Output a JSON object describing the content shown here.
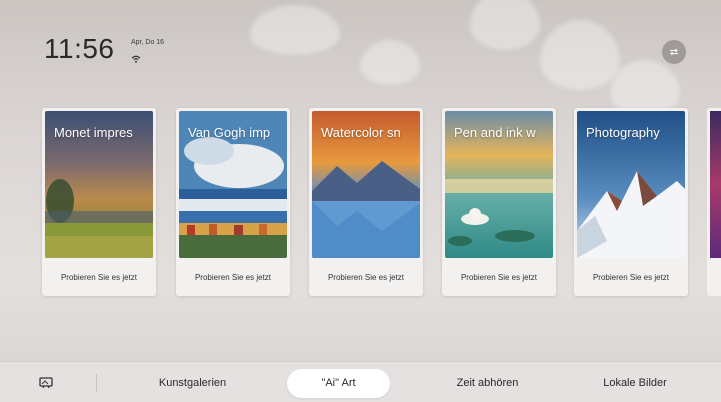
{
  "status": {
    "time": "11:56",
    "date": "Apr, Do 16"
  },
  "cards": [
    {
      "title": "Monet impres",
      "button": "Probieren Sie es jetzt"
    },
    {
      "title": "Van Gogh imp",
      "button": "Probieren Sie es jetzt"
    },
    {
      "title": "Watercolor sn",
      "button": "Probieren Sie es jetzt"
    },
    {
      "title": "Pen and ink w",
      "button": "Probieren Sie es jetzt"
    },
    {
      "title": "Photography",
      "button": "Probieren Sie es jetzt"
    }
  ],
  "nav": {
    "items": [
      {
        "label": "Kunstgalerien"
      },
      {
        "label": "\"Ai\" Art"
      },
      {
        "label": "Zeit abhören"
      },
      {
        "label": "Lokale Bilder"
      }
    ],
    "active_index": 1
  },
  "icons": {
    "wifi": "wifi-icon",
    "switch": "switch-arrows-icon",
    "frame": "picture-frame-icon"
  }
}
